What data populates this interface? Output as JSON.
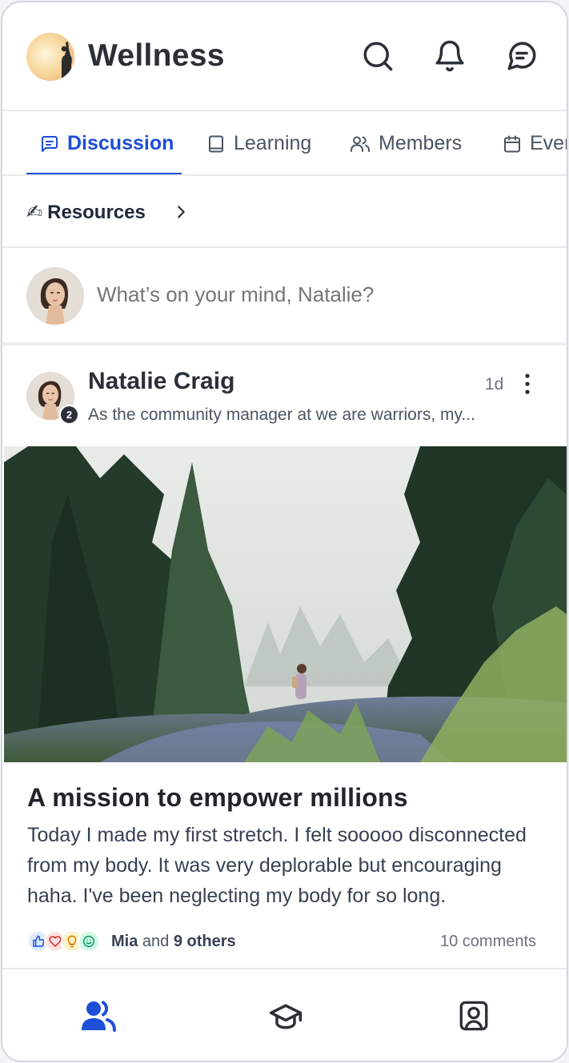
{
  "app": {
    "title": "Wellness"
  },
  "tabs": [
    {
      "label": "Discussion",
      "icon": "message-square-icon",
      "active": true
    },
    {
      "label": "Learning",
      "icon": "book-icon",
      "active": false
    },
    {
      "label": "Members",
      "icon": "users-icon",
      "active": false
    },
    {
      "label": "Events",
      "icon": "calendar-icon",
      "active": false
    }
  ],
  "resources": {
    "emoji": "✍",
    "label": "Resources"
  },
  "composer": {
    "placeholder": "What’s on your mind, Natalie?"
  },
  "post": {
    "author": "Natalie Craig",
    "badge": "2",
    "time": "1d",
    "preview": "As the community manager at we are warriors, my...",
    "title": "A mission to empower millions",
    "body": "Today I made my first stretch. I felt sooooo disconnected from my body. It was very deplorable but encouraging haha. I've been neglecting my body for so long.",
    "reactions": {
      "first_name": "Mia",
      "and_text": "and",
      "others": "9 others",
      "types": [
        "thumbs-up-icon",
        "heart-icon",
        "lightbulb-icon",
        "smile-icon"
      ]
    },
    "comments": "10 comments"
  },
  "colors": {
    "accent": "#1d4ed8",
    "text": "#1f2937",
    "muted": "#6b7280",
    "border": "#e7e9ec"
  }
}
